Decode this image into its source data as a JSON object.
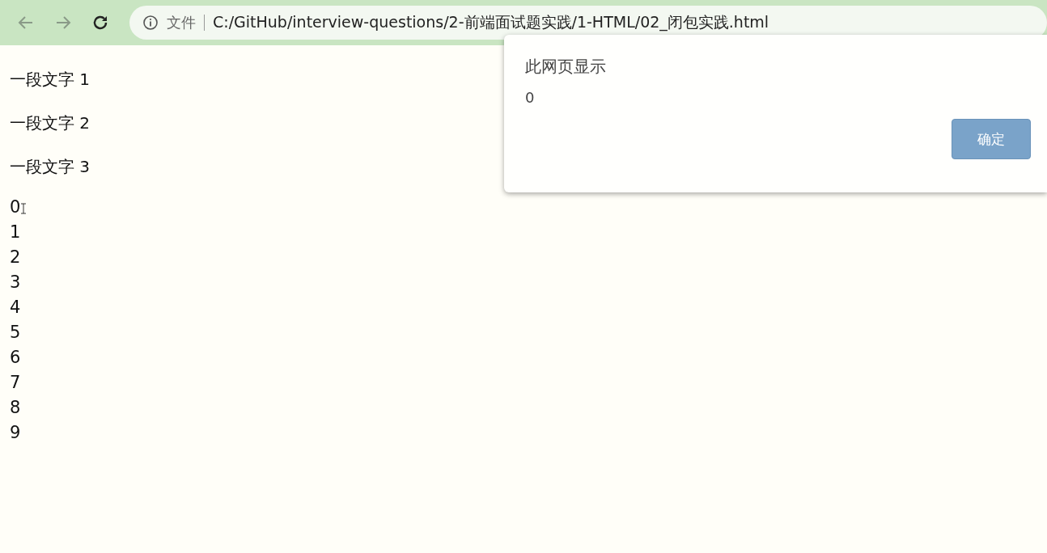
{
  "browser": {
    "origin_label": "文件",
    "url": "C:/GitHub/interview-questions/2-前端面试题实践/1-HTML/02_闭包实践.html"
  },
  "paragraphs": [
    "一段文字 1",
    "一段文字 2",
    "一段文字 3"
  ],
  "lines": [
    "0",
    "1",
    "2",
    "3",
    "4",
    "5",
    "6",
    "7",
    "8",
    "9"
  ],
  "dialog": {
    "title": "此网页显示",
    "message": "0",
    "button": "确定"
  }
}
